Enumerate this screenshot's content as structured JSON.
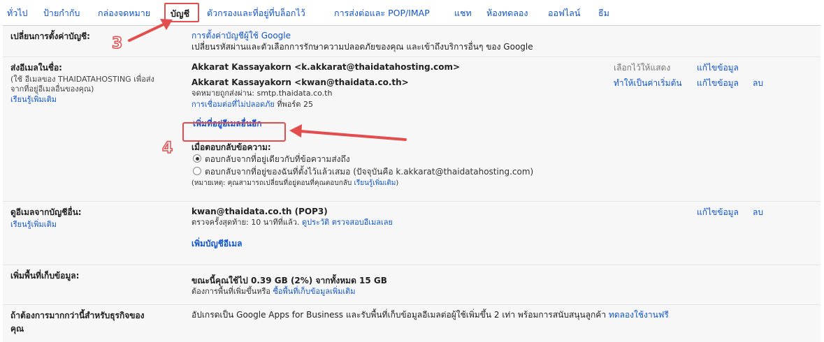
{
  "tabs": {
    "general": "ทั่วไป",
    "labels": "ป้ายกำกับ",
    "inbox": "กล่องจดหมาย",
    "accounts": "บัญชี",
    "filters": "ตัวกรองและที่อยู่ที่บล็อกไว้",
    "forwarding": "การส่งต่อและ POP/IMAP",
    "chat": "แชท",
    "labs": "ห้องทดลอง",
    "offline": "ออฟไลน์",
    "themes": "ธีม"
  },
  "change_settings": {
    "title": "เปลี่ยนการตั้งค่าบัญชี:",
    "link": "การตั้งค่าบัญชีผู้ใช้ Google",
    "desc": "เปลี่ยนรหัสผ่านและตัวเลือกการรักษาความปลอดภัยของคุณ และเข้าถึงบริการอื่นๆ ของ Google"
  },
  "send_as": {
    "title": "ส่งอีเมลในชื่อ:",
    "sub1": "(ใช้ อีเมลของ THAIDATAHOSTING เพื่อส่ง",
    "sub2": "จากที่อยู่อีเมลอื่นของคุณ)",
    "learn_more": "เรียนรู้เพิ่มเติม",
    "addr1": "Akkarat Kassayakorn <k.akkarat@thaidatahosting.com>",
    "addr1_default": "เลือกไว้ให้แสดง",
    "addr1_edit": "แก้ไขข้อมูล",
    "addr2": "Akkarat Kassayakorn <kwan@thaidata.co.th>",
    "addr2_make_default": "ทำให้เป็นค่าเริ่มต้น",
    "addr2_edit": "แก้ไขข้อมูล",
    "addr2_delete": "ลบ",
    "mail_sent_via": "จดหมายถูกส่งผ่าน: smtp.thaidata.co.th",
    "insecure_link": "การเชื่อมต่อที่ไม่ปลอดภัย",
    "port": " ที่พอร์ต 25",
    "add_another": "เพิ่มที่อยู่อีเมลอื่นอีก",
    "reply_title": "เมื่อตอบกลับข้อความ:",
    "reply_opt1": "ตอบกลับจากที่อยู่เดียวกับที่ข้อความส่งถึง",
    "reply_opt2": "ตอบกลับจากที่อยู่ของฉันที่ตั้งไว้แล้วเสมอ (ปัจจุบันคือ k.akkarat@thaidatahosting.com)",
    "note": "(หมายเหตุ: คุณสามารถเปลี่ยนที่อยู่ตอนที่คุณตอบกลับ ",
    "note_link": "เรียนรู้เพิ่มเติม",
    "note_end": ")"
  },
  "check_mail": {
    "title": "ดูอีเมลจากบัญชีอื่น:",
    "learn_more": "เรียนรู้เพิ่มเติม",
    "account": "kwan@thaidata.co.th (POP3)",
    "last_checked": "ตรวจครั้งสุดท้าย: 10 นาทีที่แล้ว. ",
    "view_history": "ดูประวัติ",
    "check_now": "ตรวจสอบอีเมลเลย",
    "edit": "แก้ไขข้อมูล",
    "delete": "ลบ",
    "add_account": "เพิ่มบัญชีอีเมล"
  },
  "storage": {
    "title": "เพิ่มพื้นที่เก็บข้อมูล:",
    "usage": "ขณะนี้คุณใช้ไป 0.39 GB (2%) จากทั้งหมด 15 GB",
    "need_more": "ต้องการพื้นที่เพิ่มขึ้นหรือ ",
    "buy_link": "ซื้อพื้นที่เก็บข้อมูลเพิ่มเติม"
  },
  "business": {
    "title_line1": "ถ้าต้องการมากกว่านี้สำหรับธุรกิจของ",
    "title_line2": "คุณ",
    "desc": "อัปเกรดเป็น Google Apps for Business และรับพื้นที่เก็บข้อมูลอีเมลต่อผู้ใช้เพิ่มขึ้น 2 เท่า พร้อมการสนับสนุนลูกค้า ",
    "trial_link": "ทดลองใช้งานฟรี"
  },
  "annotations": {
    "step3": "3",
    "step4": "4"
  },
  "colors": {
    "link": "#1155cc",
    "highlight": "#e34d4d",
    "row_bg": "#f7f7f7"
  }
}
